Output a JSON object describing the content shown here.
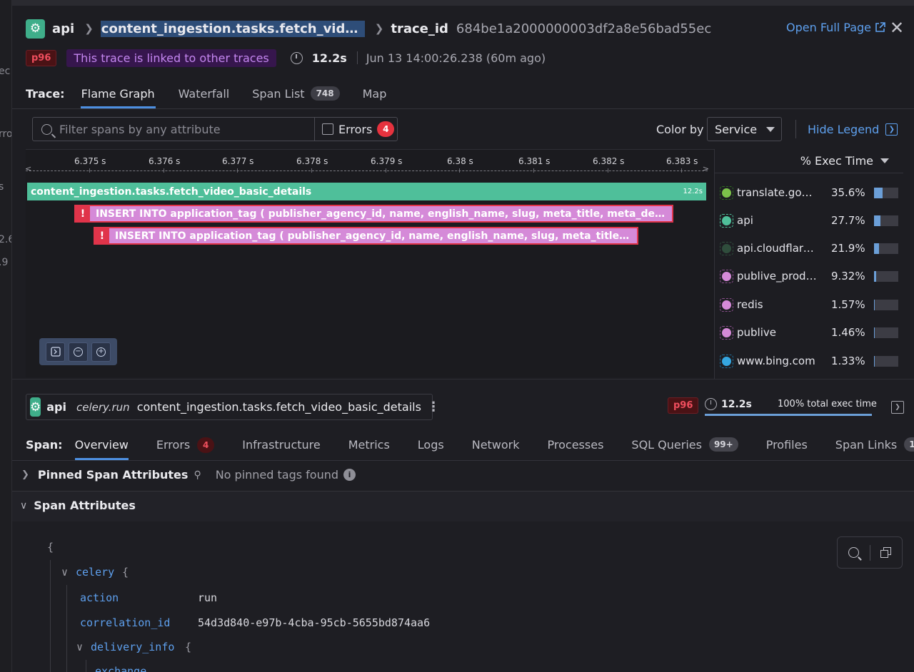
{
  "left_edge_fragments": [
    "ec",
    "rro",
    "s",
    "2.6",
    ".9"
  ],
  "header": {
    "service": "api",
    "operation": "content_ingestion.tasks.fetch_video_ba...",
    "trace_id_label": "trace_id",
    "trace_id": "684be1a2000000003df2a8e56bad55ec",
    "open_full_page": "Open Full Page",
    "close_glyph": "✕"
  },
  "meta": {
    "percentile_badge": "p96",
    "linked_text": "This trace is linked to other traces",
    "duration": "12.2s",
    "timestamp": "Jun 13 14:00:26.238 (60m ago)"
  },
  "trace_tabs": {
    "label": "Trace:",
    "items": [
      {
        "label": "Flame Graph",
        "active": true
      },
      {
        "label": "Waterfall"
      },
      {
        "label": "Span List",
        "count": "748"
      },
      {
        "label": "Map"
      }
    ]
  },
  "toolbar": {
    "filter_placeholder": "Filter spans by any attribute",
    "filter_value": "",
    "errors_label": "Errors",
    "errors_count": "4",
    "color_by_label": "Color by",
    "color_by_value": "Service",
    "hide_legend": "Hide Legend"
  },
  "flame_graph": {
    "ticks": [
      "6.375 s",
      "6.376 s",
      "6.377 s",
      "6.378 s",
      "6.379 s",
      "6.38 s",
      "6.381 s",
      "6.382 s",
      "6.383 s"
    ],
    "spans": {
      "root": {
        "name": "content_ingestion.tasks.fetch_video_basic_details",
        "duration": "12.2s",
        "color": "#4fbf9a"
      },
      "sql1": {
        "name": "INSERT INTO application_tag ( publisher_agency_id, name, english_name, slug, meta_title, meta_descri...",
        "color": "#d58ad8",
        "error": true
      },
      "sql2": {
        "name": "INSERT INTO application_tag ( publisher_agency_id, name, english_name, slug, meta_title, me...",
        "color": "#d58ad8",
        "error": true
      }
    },
    "error_glyph": "!"
  },
  "legend": {
    "header": "% Exec Time",
    "items": [
      {
        "name": "translate.googl...",
        "pct": "35.6%",
        "fraction": 0.356,
        "color": "#7cc24a",
        "border": "#2f6b22"
      },
      {
        "name": "api",
        "pct": "27.7%",
        "fraction": 0.277,
        "color": "#4fbf9a",
        "border": "#4fbf9a"
      },
      {
        "name": "api.cloudflare.c...",
        "pct": "21.9%",
        "fraction": 0.219,
        "color": "#2f4d3c",
        "border": "#2f4d3c"
      },
      {
        "name": "publive_produc...",
        "pct": "9.32%",
        "fraction": 0.0932,
        "color": "#d58ad8",
        "border": "#8a4f8c"
      },
      {
        "name": "redis",
        "pct": "1.57%",
        "fraction": 0.0157,
        "color": "#d58ad8",
        "border": "#8a4f8c"
      },
      {
        "name": "publive",
        "pct": "1.46%",
        "fraction": 0.0146,
        "color": "#d58ad8",
        "border": "#8a4f8c"
      },
      {
        "name": "www.bing.com",
        "pct": "1.33%",
        "fraction": 0.0133,
        "color": "#35a6e0",
        "border": "#1e6d99"
      }
    ]
  },
  "span_panel": {
    "service": "api",
    "kind": "celery.run",
    "name": "content_ingestion.tasks.fetch_video_basic_details",
    "percentile_badge": "p96",
    "duration": "12.2s",
    "total_exec": "100% total exec time",
    "total_exec_fraction": 1.0,
    "tabs_label": "Span:",
    "tabs": [
      {
        "label": "Overview",
        "active": true
      },
      {
        "label": "Errors",
        "count": "4"
      },
      {
        "label": "Infrastructure"
      },
      {
        "label": "Metrics"
      },
      {
        "label": "Logs"
      },
      {
        "label": "Network"
      },
      {
        "label": "Processes"
      },
      {
        "label": "SQL Queries",
        "count": "99+"
      },
      {
        "label": "Profiles"
      },
      {
        "label": "Span Links",
        "count": "1"
      }
    ],
    "pinned_title": "Pinned Span Attributes",
    "pinned_empty": "No pinned tags found",
    "attributes_title": "Span Attributes"
  },
  "attributes_json": {
    "open_brace": "{",
    "celery_key": "celery",
    "action_key": "action",
    "action_value": "run",
    "correlation_key": "correlation_id",
    "correlation_value": "54d3d840-e97b-4cba-95cb-5655bd874aa6",
    "delivery_key": "delivery_info",
    "exchange_key": "exchange"
  }
}
